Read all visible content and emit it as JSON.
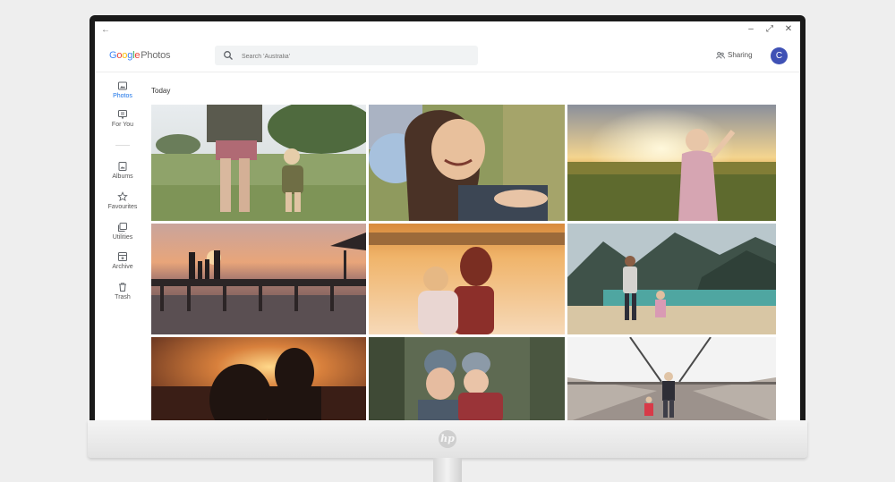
{
  "window": {
    "back_symbol": "←",
    "controls": [
      "–",
      "⤢",
      "✕"
    ]
  },
  "header": {
    "logo_letters": [
      "G",
      "o",
      "o",
      "g",
      "l",
      "e"
    ],
    "logo_product": "Photos",
    "search_placeholder": "Search 'Australia'",
    "sharing_label": "Sharing",
    "avatar_initial": "C"
  },
  "sidebar": {
    "items": [
      {
        "label": "Photos",
        "icon": "photo-icon",
        "active": true
      },
      {
        "label": "For You",
        "icon": "for-you-icon",
        "active": false
      },
      {
        "label": "Albums",
        "icon": "album-icon",
        "active": false
      },
      {
        "label": "Favourites",
        "icon": "star-icon",
        "active": false
      },
      {
        "label": "Utilities",
        "icon": "utilities-icon",
        "active": false
      },
      {
        "label": "Archive",
        "icon": "archive-icon",
        "active": false
      },
      {
        "label": "Trash",
        "icon": "trash-icon",
        "active": false
      }
    ]
  },
  "main": {
    "section_title": "Today",
    "photos": [
      {
        "scene": "mother-and-toddler-walking-in-grass"
      },
      {
        "scene": "smiling-girl-lying-in-grass"
      },
      {
        "scene": "child-raising-arm-at-sunset"
      },
      {
        "scene": "family-silhouette-on-pier"
      },
      {
        "scene": "mother-holding-child-at-beach"
      },
      {
        "scene": "mother-and-child-at-mountain-lake"
      },
      {
        "scene": "silhouette-sunset-couple"
      },
      {
        "scene": "mother-and-child-in-beanies"
      },
      {
        "scene": "father-and-child-on-bridge"
      }
    ]
  },
  "monitor": {
    "brand_mark": "hp"
  }
}
